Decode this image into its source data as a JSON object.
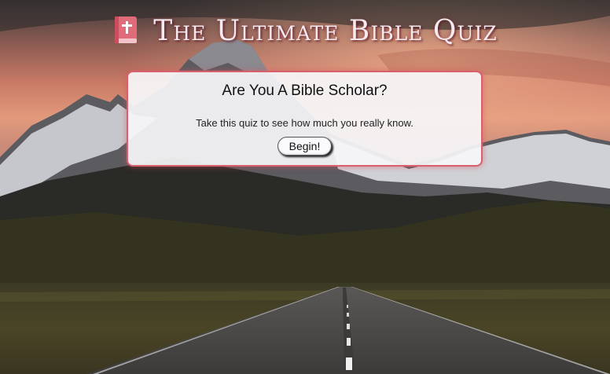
{
  "header": {
    "title": "The Ultimate Bible Quiz",
    "icon": "bible-book-icon",
    "icon_color": "#e06b79"
  },
  "card": {
    "heading": "Are You A Bible Scholar?",
    "text": "Take this quiz to see how much you really know.",
    "button_label": "Begin!",
    "border_color": "#d8606c"
  },
  "background": {
    "description_image": "mountain-road-sunset-background"
  }
}
